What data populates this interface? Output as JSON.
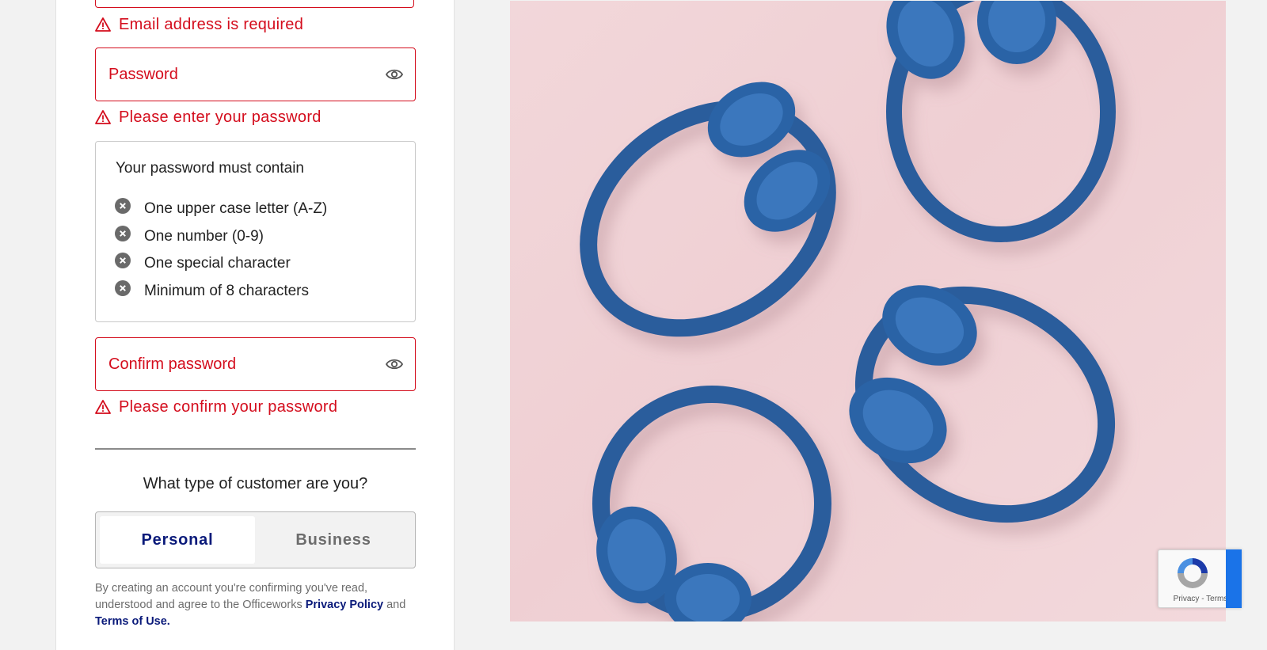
{
  "email": {
    "error": "Email address is required"
  },
  "password": {
    "label": "Password",
    "error": "Please enter your password"
  },
  "password_rules": {
    "title": "Your password must contain",
    "items": [
      "One upper case letter (A-Z)",
      "One number (0-9)",
      "One special character",
      "Minimum of 8 characters"
    ]
  },
  "confirm_password": {
    "label": "Confirm password",
    "error": "Please confirm your password"
  },
  "customer_type": {
    "question": "What type of customer are you?",
    "options": [
      "Personal",
      "Business"
    ],
    "selected": "Personal"
  },
  "terms": {
    "text_before": "By creating an account you're confirming you've read, understood and agree to the Officeworks",
    "privacy_link": "Privacy Policy",
    "and": "and",
    "terms_link": "Terms of Use."
  },
  "recaptcha": {
    "links": "Privacy - Terms"
  },
  "colors": {
    "error": "#d40d1d",
    "brand_navy": "#0a1a7a",
    "headphones": "#2a5d9c",
    "hero_background": "#f2d7da"
  },
  "icons": [
    "warning-icon",
    "eye-icon",
    "close-circle-icon",
    "recaptcha-logo"
  ]
}
